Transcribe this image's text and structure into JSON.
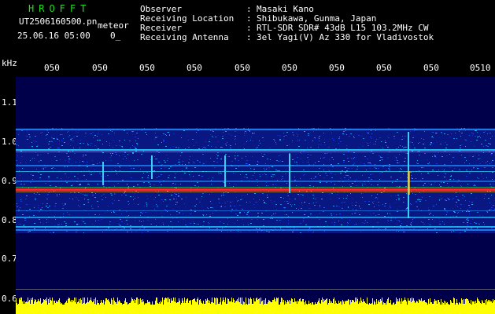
{
  "header": {
    "brand": "HROFFT",
    "filename": "UT2506160500.pn",
    "mode": "meteor",
    "datetime": "25.06.16 05:00",
    "extra": "0_",
    "fields": [
      {
        "label": "Observer",
        "sep": ":",
        "value": "Masaki Kano"
      },
      {
        "label": "Receiving Location",
        "sep": ":",
        "value": "Shibukawa, Gunma, Japan"
      },
      {
        "label": "Receiver",
        "sep": ":",
        "value": "RTL-SDR SDR# 43dB L15 103.2MHz CW"
      },
      {
        "label": "Receiving Antenna",
        "sep": ":",
        "value": "3el Yagi(V) Az 330 for Vladivostok"
      }
    ]
  },
  "axis": {
    "y_unit": "kHz",
    "y_ticks": [
      "1.1",
      "1.0",
      "0.9",
      "0.8",
      "0.7",
      "0.6"
    ],
    "x_ticks": [
      "050",
      "050",
      "050",
      "050",
      "050",
      "050",
      "050",
      "050",
      "050",
      "0510"
    ]
  },
  "colors": {
    "background": "#000000",
    "spectrum_bg": "#00004a",
    "brand": "#22dd22",
    "signal": "#ff2020",
    "noise_floor": "#ffff00"
  }
}
